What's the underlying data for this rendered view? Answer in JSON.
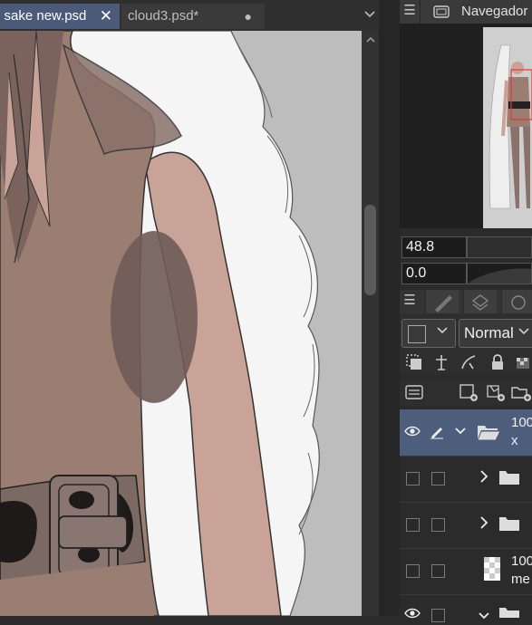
{
  "tabs": [
    {
      "label": "n sake new.psd",
      "close": "✕",
      "active": true
    },
    {
      "label": "cloud3.psd*",
      "modified_dot": "●",
      "active": false
    }
  ],
  "tab_menu_icon": "chevron-down-icon",
  "navigator": {
    "title": "Navegador",
    "zoom_value": "48.8",
    "rotation_value": "0.0"
  },
  "layers": {
    "blend_mode": "Normal",
    "rows": [
      {
        "name": "100",
        "sub": "x",
        "selected": true,
        "visible": true,
        "expanded": true
      },
      {
        "name": "",
        "selected": false,
        "visible": false,
        "expanded": false
      },
      {
        "name": "",
        "selected": false,
        "visible": false,
        "expanded": false
      },
      {
        "name": "100",
        "sub": "me",
        "selected": false,
        "visible": false
      },
      {
        "name": "",
        "selected": false,
        "visible": true,
        "expanded": true
      }
    ]
  },
  "colors": {
    "accent": "#4a5a78",
    "selected_row": "#4d5d7c",
    "panel_bg": "#2b2b2b",
    "skin": "#c9a397",
    "shirt": "#9a7e72",
    "shadow": "#6f5b56",
    "hair": "#f5f5f5"
  }
}
